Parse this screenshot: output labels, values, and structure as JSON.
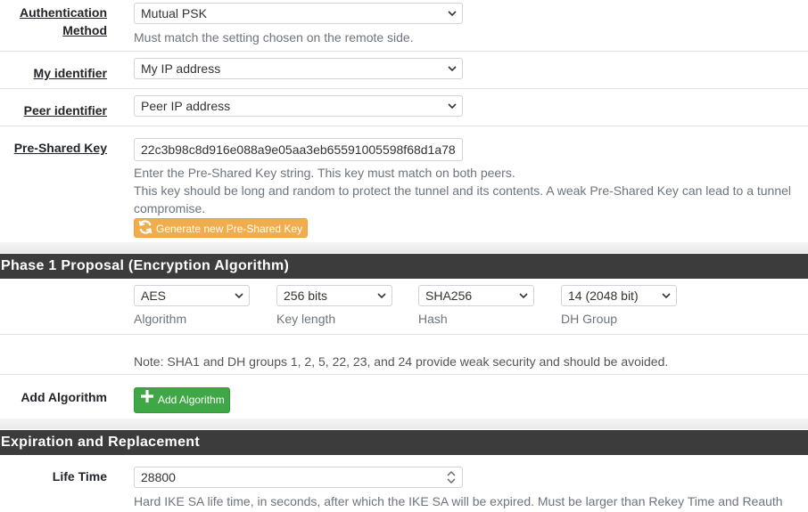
{
  "auth": {
    "label": "Authentication Method",
    "label_line1": "Authentication",
    "label_line2": "Method",
    "value": "Mutual PSK",
    "help": "Must match the setting chosen on the remote side."
  },
  "my_identifier": {
    "label": "My identifier",
    "value": "My IP address"
  },
  "peer_identifier": {
    "label": "Peer identifier",
    "value": "Peer IP address"
  },
  "psk": {
    "label": "Pre-Shared Key",
    "value": "22c3b98c8d916e088a9e05aa3eb65591005598f68d1a78",
    "help1": "Enter the Pre-Shared Key string. This key must match on both peers.",
    "help2": "This key should be long and random to protect the tunnel and its contents. A weak Pre-Shared Key can lead to a tunnel",
    "help3": "compromise.",
    "generate_label": "Generate new Pre-Shared Key"
  },
  "phase1": {
    "title": "Phase 1 Proposal (Encryption Algorithm)",
    "algorithm": {
      "value": "AES",
      "label": "Algorithm"
    },
    "key_length": {
      "value": "256 bits",
      "label": "Key length"
    },
    "hash": {
      "value": "SHA256",
      "label": "Hash"
    },
    "dh_group": {
      "value": "14 (2048 bit)",
      "label": "DH Group"
    },
    "note": "Note: SHA1 and DH groups 1, 2, 5, 22, 23, and 24 provide weak security and should be avoided.",
    "add_label": "Add Algorithm",
    "add_button": "Add Algorithm"
  },
  "expiration": {
    "title": "Expiration and Replacement",
    "life_time_label": "Life Time",
    "life_time_value": "28800",
    "life_time_help": "Hard IKE SA life time, in seconds, after which the IKE SA will be expired. Must be larger than Rekey Time and Reauth Time."
  },
  "colors": {
    "header_bg": "#3c3c3c",
    "warning": "#f0ad4e",
    "success": "#3fa746"
  },
  "icons": {
    "select": "chevron-down-icon",
    "generate": "refresh-icon",
    "add": "plus-icon",
    "spinner": "spinner-arrows-icon"
  }
}
